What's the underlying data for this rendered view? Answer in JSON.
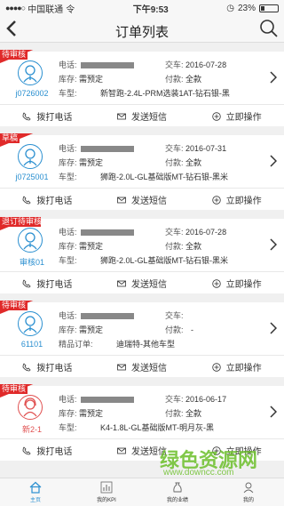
{
  "status_bar": {
    "carrier": "中国联通",
    "network": "令",
    "time": "下午9:53",
    "battery": "23%"
  },
  "nav": {
    "back_icon": "chevron-left-icon",
    "title": "订单列表",
    "search_icon": "search-icon"
  },
  "labels": {
    "phone": "电话:",
    "stock": "库存:",
    "model": "车型:",
    "delivery": "交车:",
    "payment": "付款:",
    "boutique": "精品订单:"
  },
  "actions": {
    "call": "拨打电话",
    "sms": "发送短信",
    "operate": "立即操作"
  },
  "orders": [
    {
      "badge": "待审核",
      "user": "j0726002",
      "stock": "需预定",
      "delivery": "2016-07-28",
      "payment": "全款",
      "model": "新智跑-2.4L-PRM选装1AT-钻石银-黑"
    },
    {
      "badge": "草稿",
      "user": "j0725001",
      "stock": "需预定",
      "delivery": "2016-07-31",
      "payment": "全款",
      "model": "狮跑-2.0L-GL基础版MT-钻石银-黑米"
    },
    {
      "badge": "退订待审核",
      "user": "审核01",
      "stock": "需预定",
      "delivery": "2016-07-28",
      "payment": "全款",
      "model": "狮跑-2.0L-GL基础版MT-钻石银-黑米"
    },
    {
      "badge": "待审核",
      "user": "61101",
      "stock": "需预定",
      "delivery": "",
      "payment": "-",
      "boutique_value": "迪瑞特-其他车型"
    },
    {
      "badge": "待审核",
      "user": "新2-1",
      "stock": "需预定",
      "delivery": "2016-06-17",
      "payment": "全款",
      "model": "K4-1.8L-GL基础版MT-明月灰-黑"
    }
  ],
  "tabbar": [
    {
      "label": "主页",
      "icon": "home-icon"
    },
    {
      "label": "我的KPI",
      "icon": "bar-chart-icon"
    },
    {
      "label": "我的业绩",
      "icon": "money-bag-icon"
    },
    {
      "label": "我的",
      "icon": "person-icon"
    }
  ],
  "watermark": {
    "text": "绿色资源网",
    "url": "www.downcc.com"
  },
  "colors": {
    "accent": "#2a8fd0",
    "badge": "#e02a2a",
    "watermark": "#6cbf2a"
  }
}
